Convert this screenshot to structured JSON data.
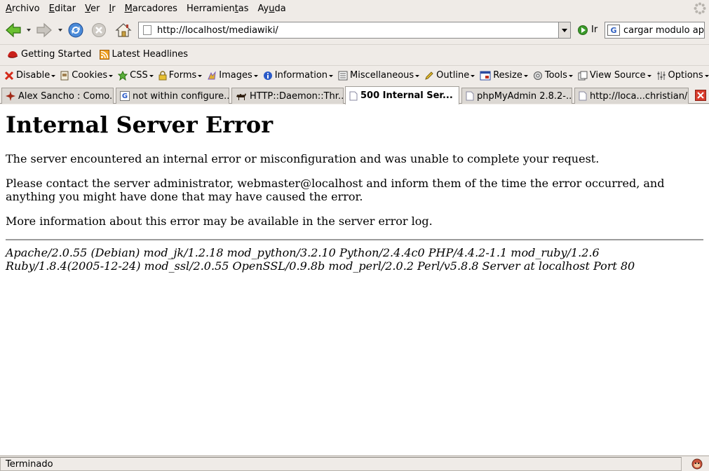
{
  "menu": {
    "items": [
      {
        "label": "Archivo",
        "accel": "A",
        "rest": "rchivo"
      },
      {
        "label": "Editar",
        "accel": "E",
        "rest": "ditar"
      },
      {
        "label": "Ver",
        "accel": "V",
        "rest": "er"
      },
      {
        "label": "Ir",
        "accel": "I",
        "rest": "r"
      },
      {
        "label": "Marcadores",
        "accel": "M",
        "rest": "arcadores"
      },
      {
        "label": "Herramientas",
        "pre": "Herramien",
        "accel": "t",
        "rest": "as"
      },
      {
        "label": "Ayuda",
        "pre": "Ay",
        "accel": "u",
        "rest": "da"
      }
    ]
  },
  "nav": {
    "url": "http://localhost/mediawiki/",
    "go_label": "Ir",
    "search_value": "cargar modulo ap",
    "search_engine_icon": "G"
  },
  "bookmarks": [
    {
      "label": "Getting Started",
      "icon": "redhat-icon"
    },
    {
      "label": "Latest Headlines",
      "icon": "rss-icon"
    }
  ],
  "devbar": [
    {
      "label": "Disable",
      "icon": "disable-icon",
      "color": "#d42a1a"
    },
    {
      "label": "Cookies",
      "icon": "cookie-icon",
      "color": "#6a5a3a"
    },
    {
      "label": "CSS",
      "icon": "css-icon",
      "color": "#3aa02a"
    },
    {
      "label": "Forms",
      "icon": "lock-icon",
      "color": "#d8a820"
    },
    {
      "label": "Images",
      "icon": "images-icon",
      "color": "#7a5ac0"
    },
    {
      "label": "Information",
      "icon": "info-icon",
      "color": "#2a5ac8"
    },
    {
      "label": "Miscellaneous",
      "icon": "misc-icon",
      "color": "#555555"
    },
    {
      "label": "Outline",
      "icon": "pencil-icon",
      "color": "#d8a820"
    },
    {
      "label": "Resize",
      "icon": "resize-icon",
      "color": "#2a4aa0"
    },
    {
      "label": "Tools",
      "icon": "gear-icon",
      "color": "#555555"
    },
    {
      "label": "View Source",
      "icon": "source-icon",
      "color": "#555555"
    },
    {
      "label": "Options",
      "icon": "options-icon",
      "color": "#555555"
    }
  ],
  "tabs": [
    {
      "label": "Alex Sancho : Como...",
      "icon": "star-icon",
      "active": false
    },
    {
      "label": "not within configure...",
      "icon": "google-icon",
      "active": false
    },
    {
      "label": "HTTP::Daemon::Thr...",
      "icon": "camel-icon",
      "active": false
    },
    {
      "label": "500 Internal Ser...",
      "icon": "page-icon",
      "active": true
    },
    {
      "label": "phpMyAdmin 2.8.2-...",
      "icon": "page-icon",
      "active": false
    },
    {
      "label": "http://loca...christian/",
      "icon": "page-icon",
      "active": false
    }
  ],
  "page": {
    "title": "Internal Server Error",
    "para1": "The server encountered an internal error or misconfiguration and was unable to complete your request.",
    "para2": "Please contact the server administrator, webmaster@localhost and inform them of the time the error occurred, and anything you might have done that may have caused the error.",
    "para3": "More information about this error may be available in the server error log.",
    "address_line1": "Apache/2.0.55 (Debian) mod_jk/1.2.18 mod_python/3.2.10 Python/2.4.4c0 PHP/4.4.2-1.1 mod_ruby/1.2.6",
    "address_line2": "Ruby/1.8.4(2005-12-24) mod_ssl/2.0.55 OpenSSL/0.9.8b mod_perl/2.0.2 Perl/v5.8.8 Server at localhost Port 80"
  },
  "status": {
    "text": "Terminado"
  }
}
